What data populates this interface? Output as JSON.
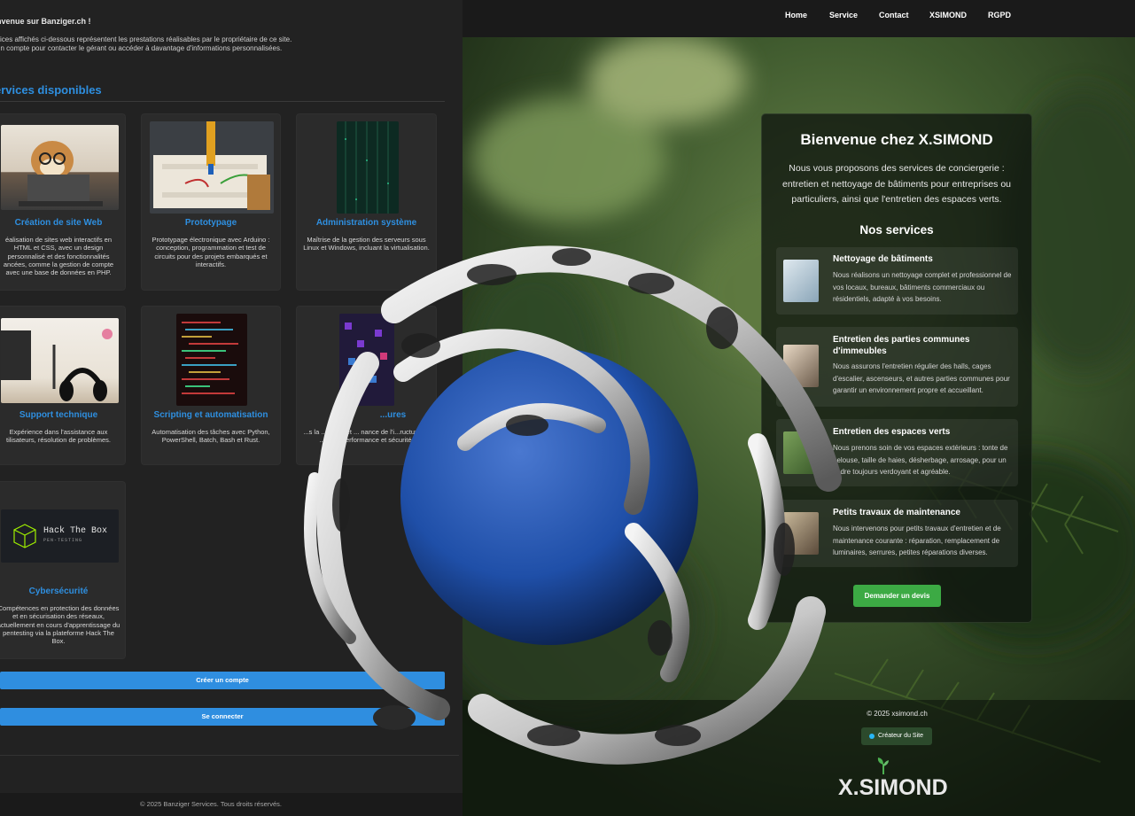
{
  "left_page": {
    "welcome": "nvenue sur Banziger.ch !",
    "intro_line1": "vices affichés ci-dessous représentent les prestations réalisables par le propriétaire de ce site.",
    "intro_line2": "un compte pour contacter le gérant ou accéder à davantage d'informations personnalisées.",
    "section_title": "ervices disponibles",
    "cards": [
      {
        "title": "Création de site Web",
        "desc": "éalisation de sites web interactifs en HTML et CSS, avec un design personnalisé et des fonctionnalités ancées, comme la gestion de compte avec une base de données en PHP.",
        "image": "cat-laptop"
      },
      {
        "title": "Prototypage",
        "desc": "Prototypage électronique avec Arduino : conception, programmation et test de circuits pour des projets embarqués et interactifs.",
        "image": "breadboard"
      },
      {
        "title": "Administration système",
        "desc": "Maîtrise de la gestion des serveurs sous Linux et Windows, incluant la virtualisation.",
        "image": "server-rack"
      },
      {
        "title": "Support technique",
        "desc": "Expérience dans l'assistance aux tilisateurs, résolution de problèmes.",
        "image": "headset-desk"
      },
      {
        "title": "Scripting et automatisation",
        "desc": "Automatisation des tâches avec Python, PowerShell, Batch, Bash et Rust.",
        "image": "code-screen"
      },
      {
        "title": "...ures",
        "desc": "...s la ... place et ... nance de l'i...ructure IT, ...urant performance et sécurité.",
        "image": "network-cables"
      },
      {
        "title": "Cybersécurité",
        "desc": "Compétences en protection des données et en sécurisation des réseaux, actuellement en cours d'apprentissage du pentesting via la plateforme Hack The Box.",
        "image": "hackthebox-logo"
      }
    ],
    "htb_logo_main": "Hack The Box",
    "htb_logo_sub": "PEN-TESTING",
    "create_account_label": "Créer un compte",
    "login_label": "Se connecter",
    "footer": "© 2025 Banziger Services. Tous droits réservés."
  },
  "right_page": {
    "nav": [
      "Home",
      "Service",
      "Contact",
      "XSIMOND",
      "RGPD"
    ],
    "title": "Bienvenue chez X.SIMOND",
    "intro": "Nous vous proposons des services de conciergerie : entretien et nettoyage de bâtiments pour entreprises ou particuliers, ainsi que l'entretien des espaces verts.",
    "services_heading": "Nos services",
    "services": [
      {
        "title": "Nettoyage de bâtiments",
        "desc": "Nous réalisons un nettoyage complet et professionnel de vos locaux, bureaux, bâtiments commerciaux ou résidentiels, adapté à vos besoins."
      },
      {
        "title": "Entretien des parties communes d'immeubles",
        "desc": "Nous assurons l'entretien régulier des halls, cages d'escalier, ascenseurs, et autres parties communes pour garantir un environnement propre et accueillant."
      },
      {
        "title": "Entretien des espaces verts",
        "desc": "Nous prenons soin de vos espaces extérieurs : tonte de pelouse, taille de haies, désherbage, arrosage, pour un cadre toujours verdoyant et agréable."
      },
      {
        "title": "Petits travaux de maintenance",
        "desc": "Nous intervenons pour petits travaux d'entretien et de maintenance courante : réparation, remplacement de luminaires, serrures, petites réparations diverses."
      }
    ],
    "quote_button": "Demander un devis",
    "copyright": "© 2025 xsimond.ch",
    "creator_label": "Créateur du Site",
    "logo_text": "X.SIMOND"
  },
  "colors": {
    "left_accent": "#2e8fe0",
    "right_accent": "#3caa44",
    "sphere": "#1f4fa8"
  }
}
